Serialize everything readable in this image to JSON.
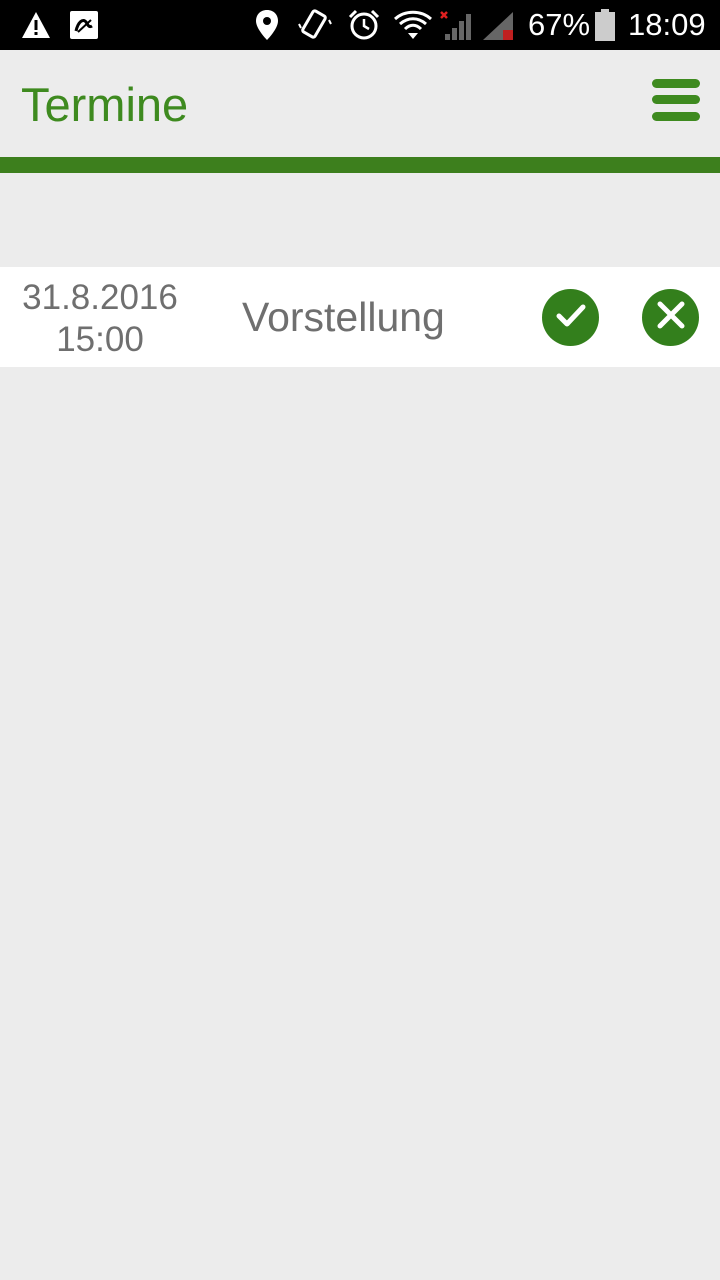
{
  "status_bar": {
    "battery_percent": "67%",
    "time": "18:09",
    "icons": [
      "warning-icon",
      "app-notification-icon",
      "location-icon",
      "vibrate-icon",
      "alarm-icon",
      "wifi-icon",
      "signal-icon",
      "signal-icon-2",
      "battery-icon"
    ]
  },
  "header": {
    "title": "Termine",
    "menu_icon": "hamburger-menu-icon"
  },
  "appointments": [
    {
      "date": "31.8.2016",
      "time": "15:00",
      "title": "Vorstellung",
      "accept_icon": "check-icon",
      "decline_icon": "close-icon"
    }
  ],
  "colors": {
    "accent": "#3e8a1f",
    "accent_dark": "#337f1c",
    "background": "#ececec",
    "text_gray": "#6f6f6f"
  }
}
